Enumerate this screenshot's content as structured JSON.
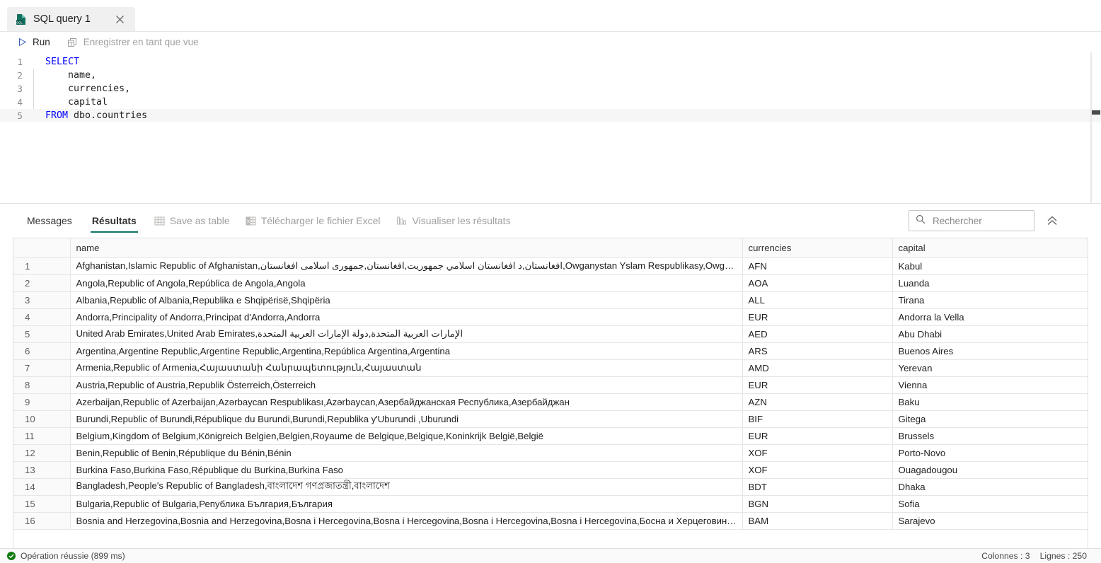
{
  "tab": {
    "label": "SQL query 1",
    "icon": "sql-file-icon",
    "close_icon": "close-icon"
  },
  "toolbar": {
    "run_label": "Run",
    "run_icon": "play-icon",
    "save_view_label": "Enregistrer en tant que vue",
    "save_view_icon": "save-as-view-icon"
  },
  "editor": {
    "lines": [
      {
        "num": "1",
        "indent": false,
        "tokens": [
          {
            "t": "SELECT",
            "c": "kw"
          }
        ]
      },
      {
        "num": "2",
        "indent": true,
        "tokens": [
          {
            "t": "    name,",
            "c": "idn"
          }
        ]
      },
      {
        "num": "3",
        "indent": true,
        "tokens": [
          {
            "t": "    currencies,",
            "c": "idn"
          }
        ]
      },
      {
        "num": "4",
        "indent": true,
        "tokens": [
          {
            "t": "    capital",
            "c": "idn"
          }
        ]
      },
      {
        "num": "5",
        "indent": false,
        "tokens": [
          {
            "t": "FROM",
            "c": "kw"
          },
          {
            "t": " dbo.countries",
            "c": "idn"
          }
        ]
      }
    ]
  },
  "results": {
    "tabs": [
      {
        "label": "Messages",
        "active": false
      },
      {
        "label": "Résultats",
        "active": true
      }
    ],
    "actions": [
      {
        "label": "Save as table",
        "icon": "table-icon"
      },
      {
        "label": "Télécharger le fichier Excel",
        "icon": "excel-icon"
      },
      {
        "label": "Visualiser les résultats",
        "icon": "chart-bars-icon"
      }
    ],
    "search": {
      "placeholder": "Rechercher",
      "value": "",
      "icon": "search-icon"
    },
    "collapse": {
      "icon": "double-chevron-up-icon"
    },
    "columns": [
      "name",
      "currencies",
      "capital"
    ],
    "rows": [
      {
        "n": "1",
        "name": "Afghanistan,Islamic Republic of Afghanistan,افغانستان,د افغانستان اسلامي جمهوریت,افغانستان,جمهوری اسلامی افغانستان,Owganystan Yslam Respublikasy,Owganystan",
        "currencies": "AFN",
        "capital": "Kabul"
      },
      {
        "n": "2",
        "name": "Angola,Republic of Angola,República de Angola,Angola",
        "currencies": "AOA",
        "capital": "Luanda"
      },
      {
        "n": "3",
        "name": "Albania,Republic of Albania,Republika e Shqipërisë,Shqipëria",
        "currencies": "ALL",
        "capital": "Tirana"
      },
      {
        "n": "4",
        "name": "Andorra,Principality of Andorra,Principat d'Andorra,Andorra",
        "currencies": "EUR",
        "capital": "Andorra la Vella"
      },
      {
        "n": "5",
        "name": "United Arab Emirates,United Arab Emirates,الإمارات العربية المتحدة,دولة الإمارات العربية المتحدة",
        "currencies": "AED",
        "capital": "Abu Dhabi"
      },
      {
        "n": "6",
        "name": "Argentina,Argentine Republic,Argentine Republic,Argentina,República Argentina,Argentina",
        "currencies": "ARS",
        "capital": "Buenos Aires"
      },
      {
        "n": "7",
        "name": "Armenia,Republic of Armenia,Հայաստանի Հանրապետություն,Հայաստան",
        "currencies": "AMD",
        "capital": "Yerevan"
      },
      {
        "n": "8",
        "name": "Austria,Republic of Austria,Republik Österreich,Österreich",
        "currencies": "EUR",
        "capital": "Vienna"
      },
      {
        "n": "9",
        "name": "Azerbaijan,Republic of Azerbaijan,Azərbaycan Respublikası,Azərbaycan,Азербайджанская Республика,Азербайджан",
        "currencies": "AZN",
        "capital": "Baku"
      },
      {
        "n": "10",
        "name": "Burundi,Republic of Burundi,République du Burundi,Burundi,Republika y'Uburundi ,Uburundi",
        "currencies": "BIF",
        "capital": "Gitega"
      },
      {
        "n": "11",
        "name": "Belgium,Kingdom of Belgium,Königreich Belgien,Belgien,Royaume de Belgique,Belgique,Koninkrijk België,België",
        "currencies": "EUR",
        "capital": "Brussels"
      },
      {
        "n": "12",
        "name": "Benin,Republic of Benin,République du Bénin,Bénin",
        "currencies": "XOF",
        "capital": "Porto-Novo"
      },
      {
        "n": "13",
        "name": "Burkina Faso,Burkina Faso,République du Burkina,Burkina Faso",
        "currencies": "XOF",
        "capital": "Ouagadougou"
      },
      {
        "n": "14",
        "name": "Bangladesh,People's Republic of Bangladesh,বাংলাদেশ গণপ্রজাতন্ত্রী,বাংলাদেশ",
        "currencies": "BDT",
        "capital": "Dhaka"
      },
      {
        "n": "15",
        "name": "Bulgaria,Republic of Bulgaria,Република България,България",
        "currencies": "BGN",
        "capital": "Sofia"
      },
      {
        "n": "16",
        "name": "Bosnia and Herzegovina,Bosnia and Herzegovina,Bosna i Hercegovina,Bosna i Hercegovina,Bosna i Hercegovina,Bosna i Hercegovina,Босна и Херцеговина,Босна и Херцегов...",
        "currencies": "BAM",
        "capital": "Sarajevo"
      }
    ]
  },
  "statusbar": {
    "message": "Opération réussie (899 ms)",
    "status_icon": "success-check-icon",
    "columns_label": "Colonnes :  3",
    "rows_label": "Lignes :  250"
  },
  "colors": {
    "accent": "#0f7368",
    "keyword": "#0000ff",
    "success": "#107c10",
    "muted": "#a19f9d"
  }
}
